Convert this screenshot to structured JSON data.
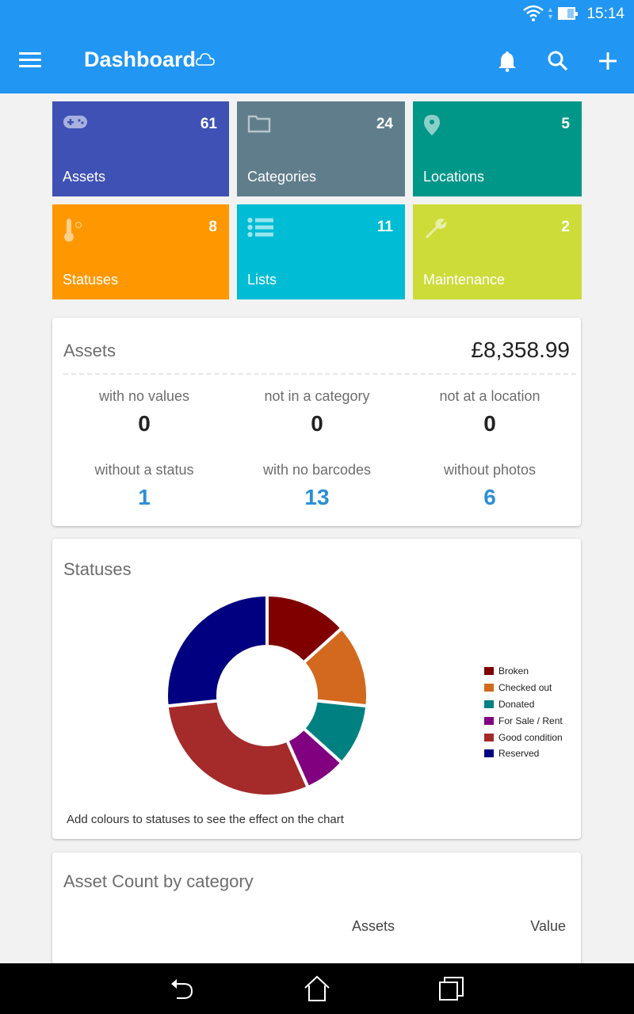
{
  "status_bar": {
    "time": "15:14",
    "icons": [
      "wifi-icon",
      "data-arrows-icon",
      "battery-icon"
    ]
  },
  "app_bar": {
    "title": "Dashboard",
    "icons": [
      "menu-icon",
      "cloud-sync-icon",
      "bell-icon",
      "search-icon",
      "add-icon"
    ]
  },
  "tiles": [
    {
      "label": "Assets",
      "count": "61",
      "icon": "gamepad-icon",
      "color": "#3f51b5"
    },
    {
      "label": "Categories",
      "count": "24",
      "icon": "folder-icon",
      "color": "#607d8b"
    },
    {
      "label": "Locations",
      "count": "5",
      "icon": "location-pin-icon",
      "color": "#009688"
    },
    {
      "label": "Statuses",
      "count": "8",
      "icon": "thermometer-icon",
      "color": "#ff9800"
    },
    {
      "label": "Lists",
      "count": "11",
      "icon": "list-icon",
      "color": "#00bcd4"
    },
    {
      "label": "Maintenance",
      "count": "2",
      "icon": "wrench-icon",
      "color": "#cddc39"
    }
  ],
  "assets_summary": {
    "title": "Assets",
    "total_value": "£8,358.99",
    "metrics": [
      {
        "label": "with no values",
        "value": "0"
      },
      {
        "label": "not in a category",
        "value": "0"
      },
      {
        "label": "not at a location",
        "value": "0"
      },
      {
        "label": "without a status",
        "value": "1"
      },
      {
        "label": "with no barcodes",
        "value": "13"
      },
      {
        "label": "without photos",
        "value": "6"
      }
    ]
  },
  "statuses_card": {
    "title": "Statuses",
    "note": "Add colours to statuses to see the effect on the chart"
  },
  "chart_data": {
    "type": "pie",
    "variant": "donut",
    "title": "Statuses",
    "categories": [
      "Broken",
      "Checked out",
      "Donated",
      "For Sale / Rent",
      "Good condition",
      "Reserved"
    ],
    "values": [
      4,
      4,
      3,
      2,
      9,
      8
    ],
    "colors": [
      "#800000",
      "#d2691e",
      "#008080",
      "#800080",
      "#a52a2a",
      "#000080"
    ],
    "legend_position": "right"
  },
  "category_card": {
    "title": "Asset Count by category",
    "columns": [
      "Assets",
      "Value"
    ]
  },
  "nav_bar": {
    "buttons": [
      "back-icon",
      "home-icon",
      "recents-icon"
    ]
  }
}
